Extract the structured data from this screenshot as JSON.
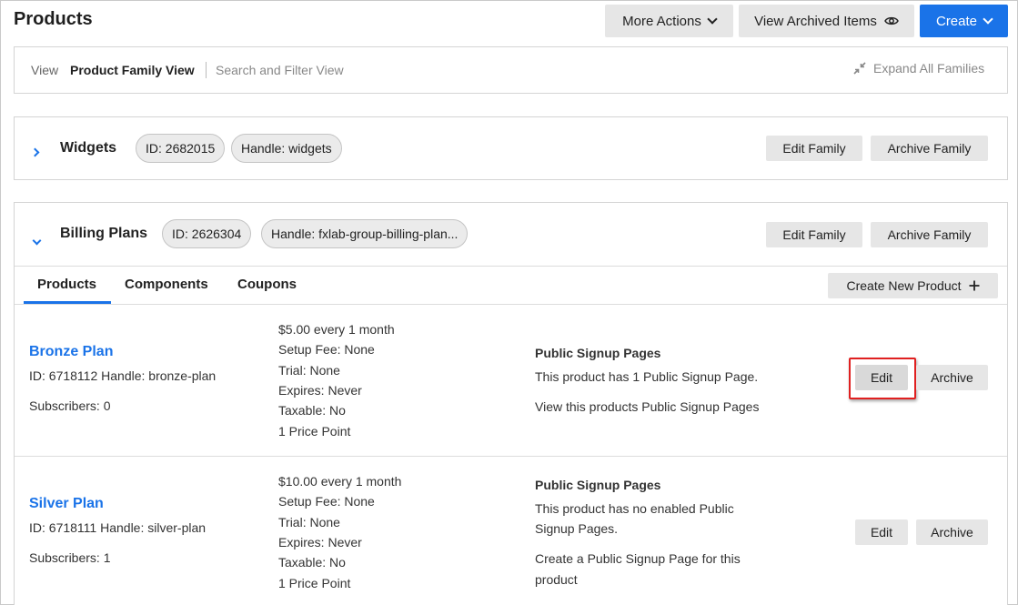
{
  "header": {
    "title": "Products",
    "more_actions": "More Actions",
    "view_archived": "View Archived Items",
    "create": "Create"
  },
  "viewbar": {
    "view_label": "View",
    "active_view": "Product Family View",
    "alt_view": "Search and Filter View",
    "expand_all": "Expand All Families"
  },
  "families": [
    {
      "name": "Widgets",
      "id": "ID: 2682015",
      "handle": "Handle: widgets",
      "edit": "Edit Family",
      "archive": "Archive Family"
    },
    {
      "name": "Billing Plans",
      "id": "ID: 2626304",
      "handle": "Handle: fxlab-group-billing-plan...",
      "edit": "Edit Family",
      "archive": "Archive Family",
      "tabs": [
        "Products",
        "Components",
        "Coupons"
      ],
      "create_new_product": "Create New Product",
      "products": [
        {
          "name": "Bronze Plan",
          "meta": "ID: 6718112 Handle: bronze-plan",
          "subscribers": "Subscribers: 0",
          "price": "$5.00 every 1 month",
          "setup_fee": "Setup Fee: None",
          "trial": "Trial: None",
          "expires": "Expires: Never",
          "taxable": "Taxable: No",
          "price_points": "1 Price Point",
          "signup_heading": "Public Signup Pages",
          "signup_text_1": "This product has 1 Public Signup Page.",
          "signup_text_2": "",
          "signup_link_1": "View this products Public Signup Pages",
          "signup_link_2": "",
          "edit": "Edit",
          "archive": "Archive"
        },
        {
          "name": "Silver Plan",
          "meta": "ID: 6718111 Handle: silver-plan",
          "subscribers": "Subscribers: 1",
          "price": "$10.00 every 1 month",
          "setup_fee": "Setup Fee: None",
          "trial": "Trial: None",
          "expires": "Expires: Never",
          "taxable": "Taxable: No",
          "price_points": "1 Price Point",
          "signup_heading": "Public Signup Pages",
          "signup_text_1": "This product has no enabled Public",
          "signup_text_2": "Signup Pages.",
          "signup_link_1": "Create a Public Signup Page for this",
          "signup_link_2": "product",
          "edit": "Edit",
          "archive": "Archive"
        }
      ]
    }
  ],
  "colors": {
    "accent": "#1a73e8",
    "highlight": "#e02020"
  }
}
